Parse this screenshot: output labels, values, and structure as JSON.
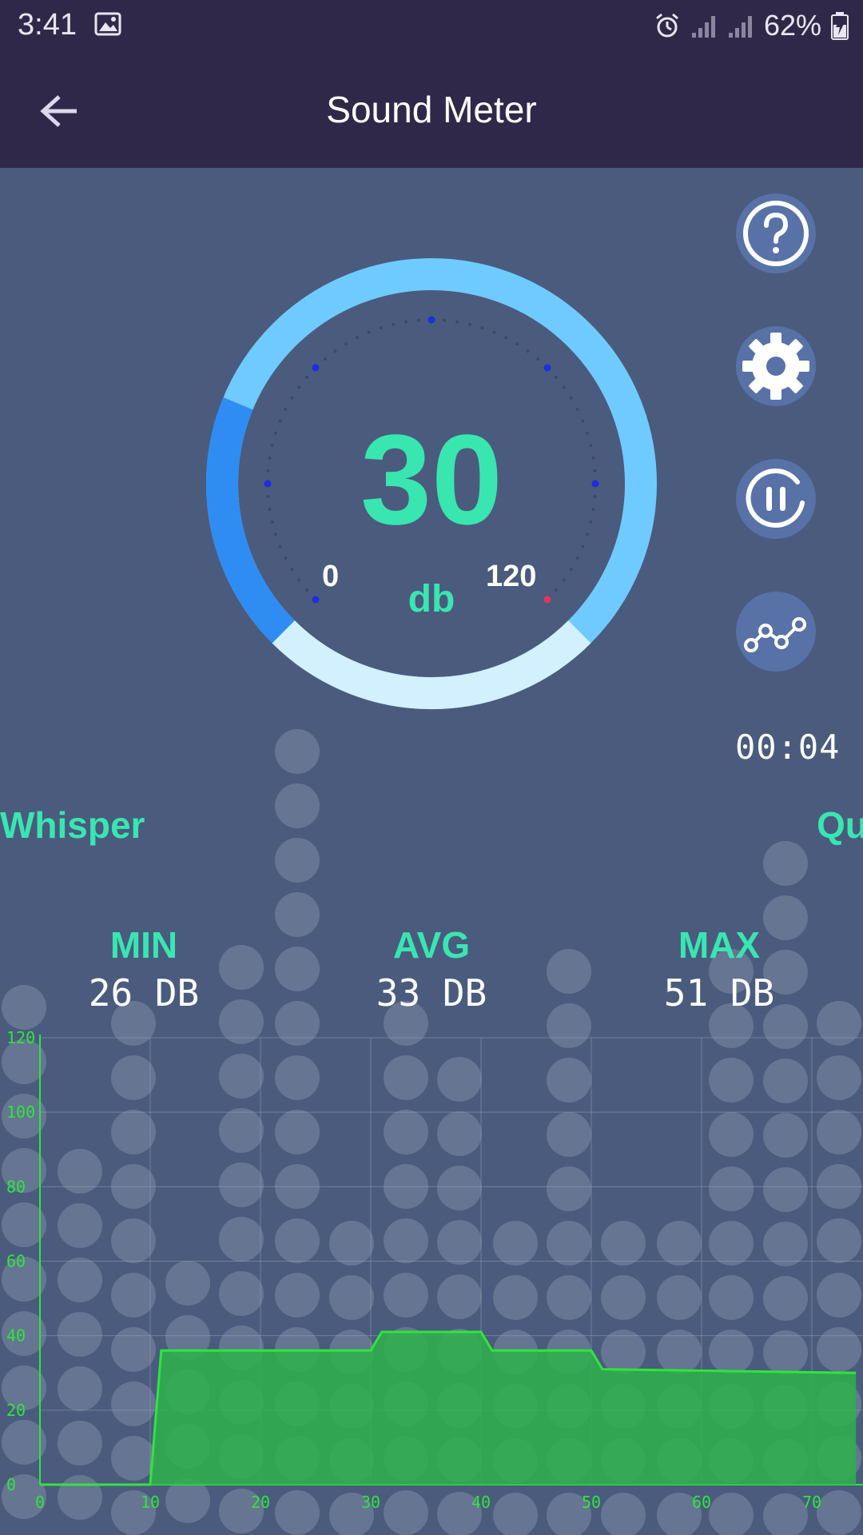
{
  "status": {
    "time": "3:41",
    "battery": "62%"
  },
  "appbar": {
    "title": "Sound Meter",
    "back_icon": "arrow-left-icon"
  },
  "gauge": {
    "value": "30",
    "unit": "db",
    "min_label": "0",
    "max_label": "120",
    "level_fraction": 0.25
  },
  "side_buttons": [
    {
      "name": "help-button",
      "icon": "question-icon"
    },
    {
      "name": "settings-button",
      "icon": "gear-icon"
    },
    {
      "name": "pause-button",
      "icon": "pause-icon"
    },
    {
      "name": "graph-button",
      "icon": "line-graph-icon"
    }
  ],
  "timer": "00:04",
  "levels": {
    "left": "Whisper",
    "right": "Qu"
  },
  "stats": {
    "min": {
      "label": "MIN",
      "value": "26 DB"
    },
    "avg": {
      "label": "AVG",
      "value": "33 DB"
    },
    "max": {
      "label": "MAX",
      "value": "51 DB"
    }
  },
  "colors": {
    "accent": "#39e6b0",
    "bar": "#302848",
    "chart_line": "#2ee63a",
    "chart_fill": "#2db34a"
  },
  "chart_data": {
    "type": "area",
    "xlim": [
      0,
      74
    ],
    "ylim": [
      0,
      120
    ],
    "x_ticks": [
      "0",
      "10",
      "20",
      "30",
      "40",
      "50",
      "60",
      "70"
    ],
    "y_ticks": [
      "0",
      "20",
      "40",
      "60",
      "80",
      "100",
      "120"
    ],
    "x": [
      0,
      10,
      11,
      30,
      31,
      40,
      41,
      50,
      51,
      74
    ],
    "y": [
      0,
      0,
      36,
      36,
      41,
      41,
      36,
      36,
      31,
      30
    ]
  }
}
